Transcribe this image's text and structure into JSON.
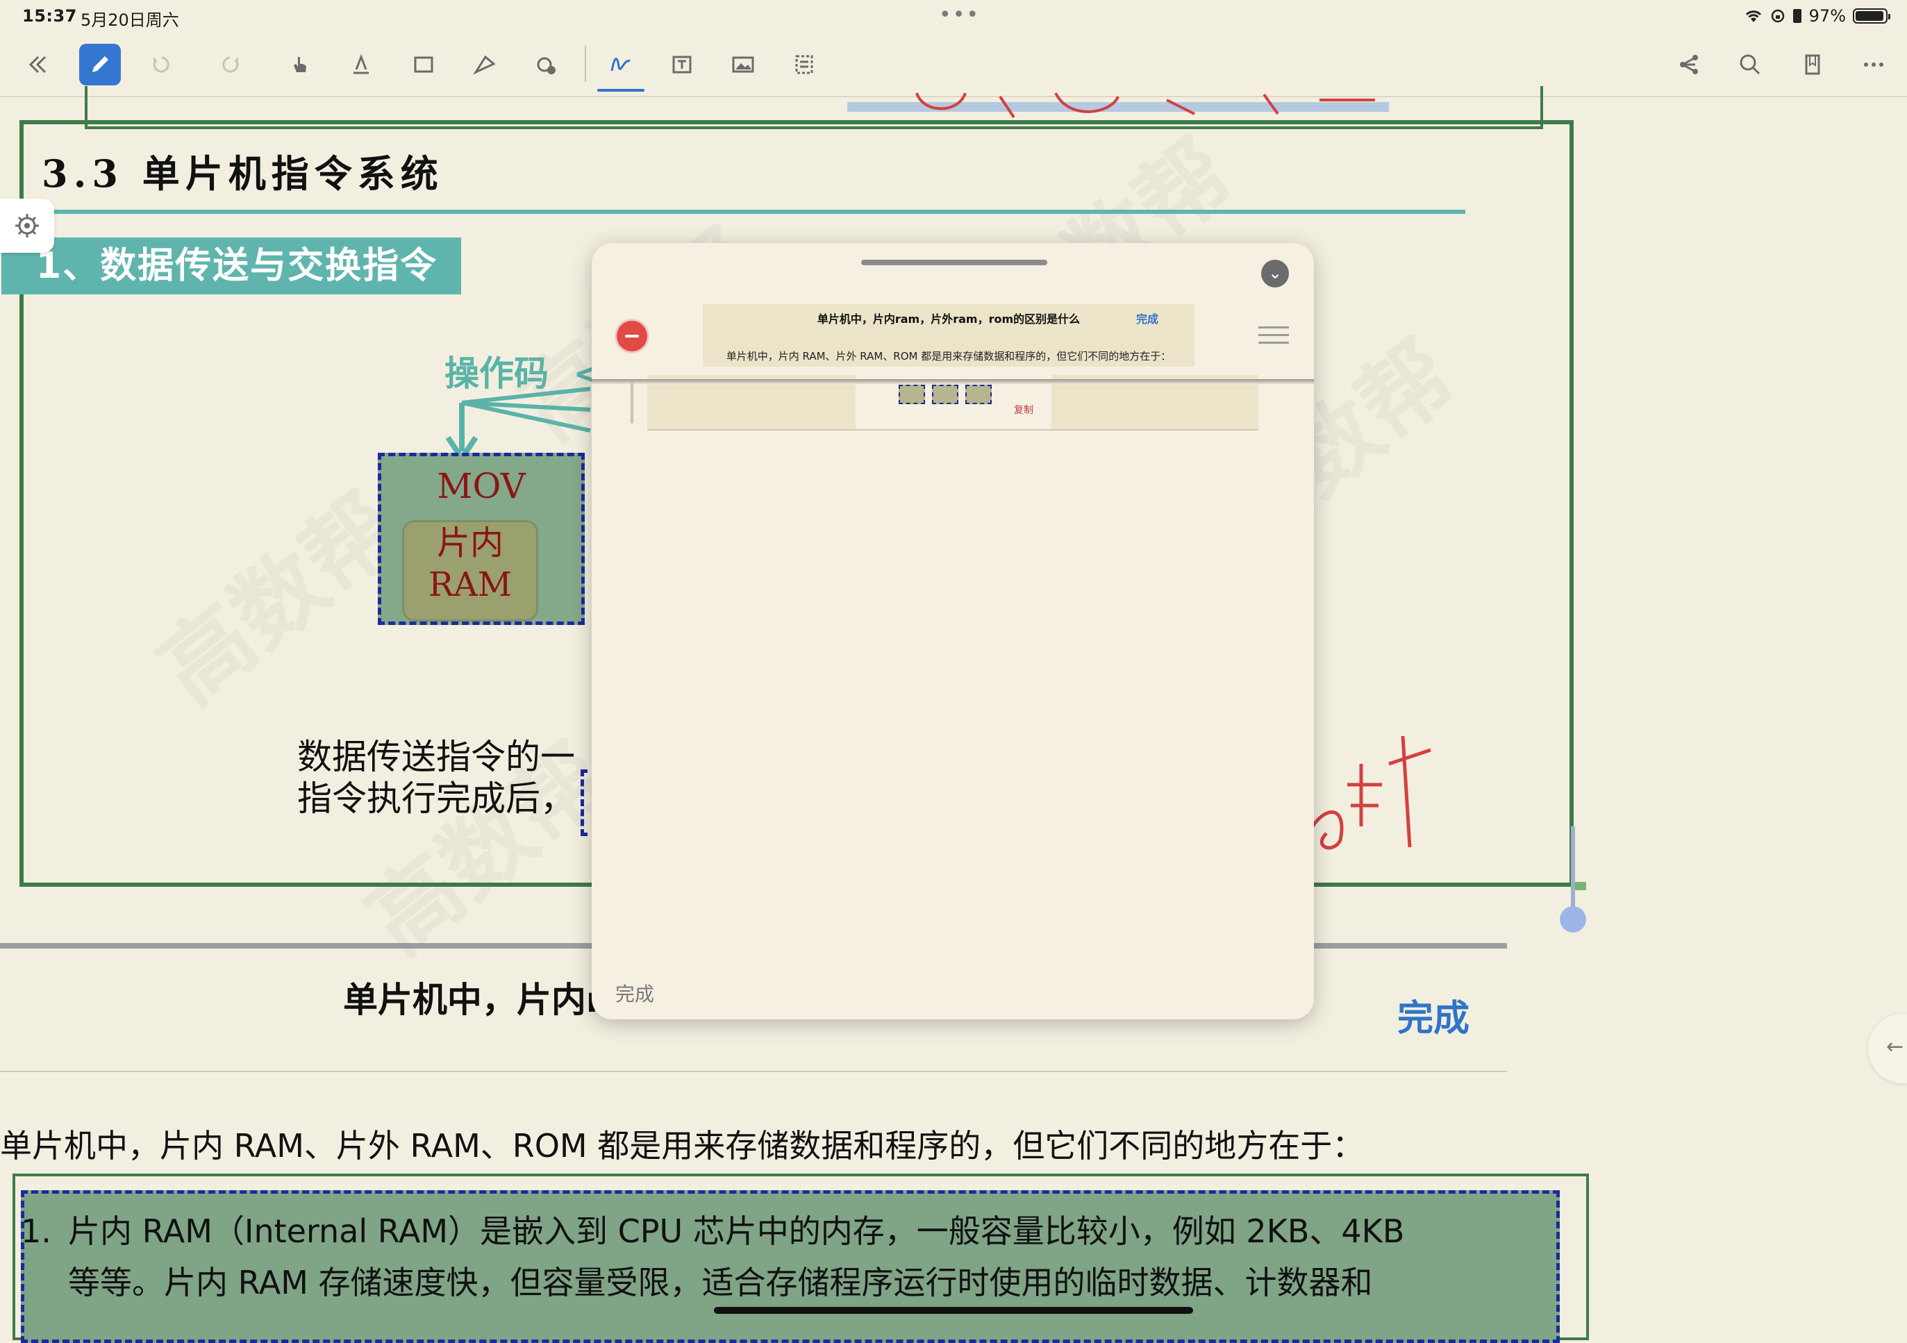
{
  "status_bar": {
    "time": "15:37",
    "date": "5月20日周六",
    "battery": "97%"
  },
  "toolbar": {
    "icons": [
      "back-icon",
      "pen-icon",
      "undo-icon",
      "redo-icon",
      "hand-icon",
      "highlighter-icon",
      "lasso-rect-icon",
      "shape-icon",
      "settings-badge-icon",
      "handwriting-icon",
      "textbox-icon",
      "image-icon",
      "outline-icon",
      "share-icon",
      "search-icon",
      "bookmark-icon",
      "more-icon"
    ],
    "accent": "#3577d0"
  },
  "document": {
    "slide_title": "3.3 单片机指令系统",
    "section_banner": "1、数据传送与交换指令",
    "opcode_label": "操作码",
    "opcode_arrow": "<",
    "mov_label": "MOV",
    "operand_label_line1": "片内",
    "operand_label_line2": "RAM",
    "note_line1": "数据传送指令的一",
    "note_line2": "指令执行完成后，",
    "handwritten": "复制"
  },
  "popup": {
    "thumb_title": "单片机中，片内ram，片外ram，rom的区别是什么",
    "thumb_done": "完成",
    "thumb_text": "单片机中，片内 RAM、片外 RAM、ROM 都是用来存储数据和程序的，但它们不同的地方在于：",
    "done_label": "完成"
  },
  "page2": {
    "title": "单片机中，片内ram，片外ram，rom的区别是什么",
    "done_label": "完成",
    "intro": "单片机中，片内 RAM、片外 RAM、ROM 都是用来存储数据和程序的，但它们不同的地方在于：",
    "item1_num": "1.",
    "item1_line1": "片内 RAM（Internal RAM）是嵌入到 CPU 芯片中的内存，一般容量比较小，例如 2KB、4KB",
    "item1_line2": "等等。片内 RAM 存储速度快，但容量受限，适合存储程序运行时使用的临时数据、计数器和"
  },
  "watermark": "高数帮"
}
